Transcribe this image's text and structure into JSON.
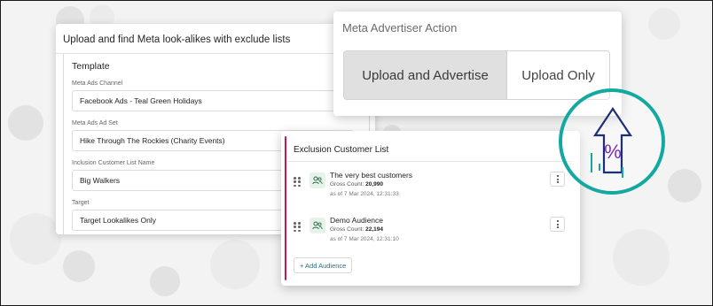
{
  "form": {
    "header": "Upload and find Meta look-alikes with exclude lists",
    "section_title": "Template",
    "fields": [
      {
        "label": "Meta Ads Channel",
        "value": "Facebook Ads - Teal Green Holidays"
      },
      {
        "label": "Meta Ads Ad Set",
        "value": "Hike Through The Rockies (Charity Events)"
      },
      {
        "label": "Inclusion Customer List Name",
        "value": "Big Walkers"
      },
      {
        "label": "Target",
        "value": "Target Lookalikes Only"
      }
    ]
  },
  "action": {
    "title": "Meta Advertiser Action",
    "options": [
      "Upload and Advertise",
      "Upload Only"
    ],
    "selected": "Upload and Advertise"
  },
  "exclusion": {
    "title": "Exclusion Customer List",
    "audiences": [
      {
        "name": "The very best customers",
        "count_label": "Gross Count:",
        "count": "20,990",
        "date": "as of 7 Mar 2024, 12:31:33"
      },
      {
        "name": "Demo Audience",
        "count_label": "Gross Count:",
        "count": "22,194",
        "date": "as of 7 Mar 2024, 12:31:10"
      }
    ],
    "add_label": "+ Add Audience"
  },
  "badge": {
    "symbol": "%",
    "icon": "upload-percent-icon"
  },
  "colors": {
    "accent_magenta": "#c2185b",
    "teal": "#13a8a0",
    "navy": "#1e2f7a",
    "purple": "#7b2cbf",
    "link": "#2b6c8f"
  }
}
